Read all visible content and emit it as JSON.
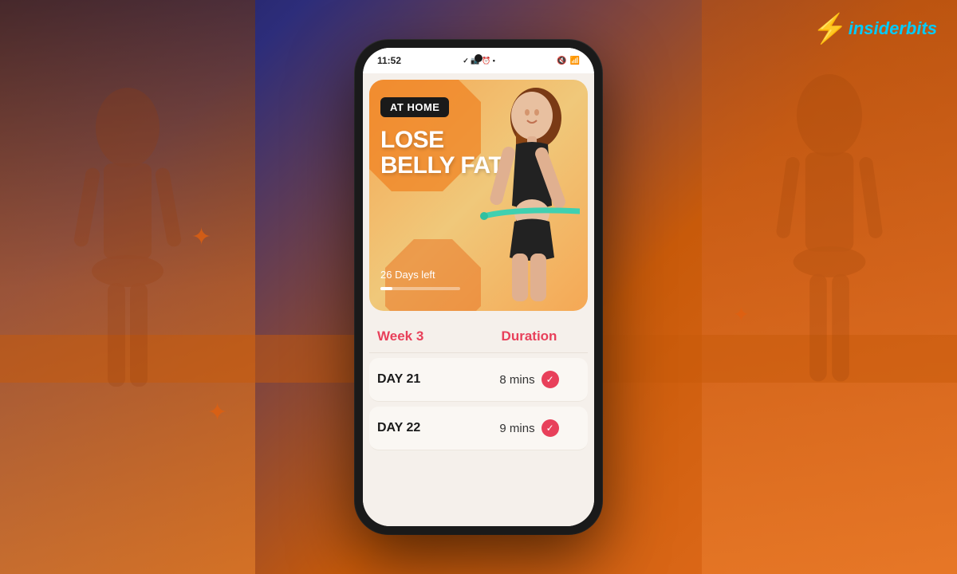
{
  "background": {
    "gradient_start": "#1a1a4e",
    "gradient_end": "#e87020"
  },
  "logo": {
    "brand_name": "insiderbits",
    "brand_highlight": "insider",
    "brand_rest": "bits"
  },
  "phone": {
    "status_bar": {
      "time": "11:52",
      "icons_left": "✓ 🖼 ⏰ •",
      "icons_right": "🔇 📶"
    },
    "hero_card": {
      "badge": "AT HOME",
      "title_line1": "LOSE",
      "title_line2": "BELLY FAT",
      "days_left": "26 Days left",
      "progress_percent": 15
    },
    "workout_table": {
      "week_label": "Week 3",
      "duration_label": "Duration",
      "days": [
        {
          "name": "DAY 21",
          "duration": "8 mins",
          "completed": true
        },
        {
          "name": "DAY 22",
          "duration": "9 mins",
          "completed": true
        }
      ]
    }
  }
}
